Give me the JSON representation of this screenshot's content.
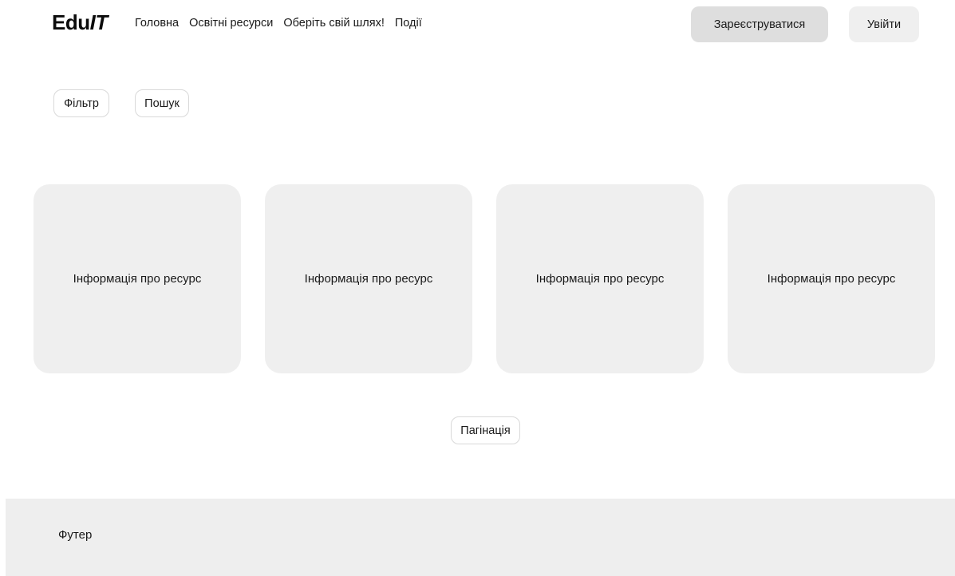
{
  "header": {
    "logo_prefix": "Edu",
    "logo_suffix": "IT",
    "nav": [
      {
        "label": "Головна"
      },
      {
        "label": "Освітні ресурси"
      },
      {
        "label": "Оберіть свій шлях!"
      },
      {
        "label": "Події"
      }
    ],
    "register_label": "Зареєструватися",
    "login_label": "Увійти"
  },
  "toolbar": {
    "filter_label": "Фільтр",
    "search_label": "Пошук"
  },
  "cards": [
    {
      "label": "Інформація про ресурс"
    },
    {
      "label": "Інформація про ресурс"
    },
    {
      "label": "Інформація про ресурс"
    },
    {
      "label": "Інформація про ресурс"
    }
  ],
  "pagination": {
    "label": "Пагінація"
  },
  "footer": {
    "label": "Футер"
  },
  "colors": {
    "card_bg": "#efefef",
    "register_bg": "#dedede",
    "login_bg": "#efefef",
    "footer_bg": "#eeeeee"
  }
}
